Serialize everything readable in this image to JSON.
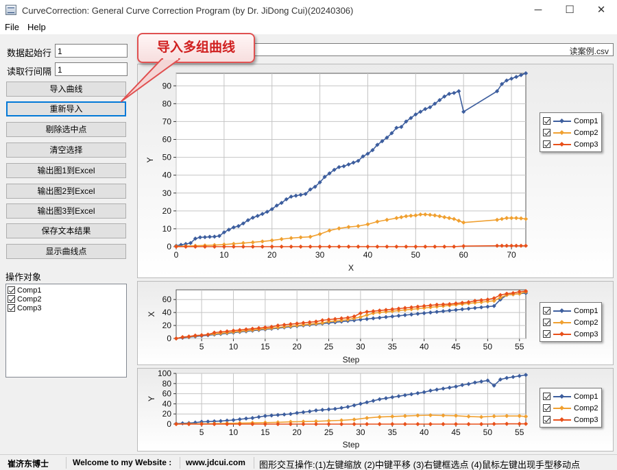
{
  "window": {
    "title": "CurveCorrection: General Curve Correction Program (by Dr. JiDong Cui)(20240306)",
    "minimize_glyph": "─",
    "maximize_glyph": "☐",
    "close_glyph": "✕"
  },
  "menu": {
    "items": [
      "File",
      "Help"
    ]
  },
  "params": {
    "start_row_label": "数据起始行",
    "start_row_value": "1",
    "interval_label": "读取行间隔",
    "interval_value": "1"
  },
  "file_path_visible": "读案例.csv",
  "buttons": [
    "导入曲线",
    "重新导入",
    "剔除选中点",
    "清空选择",
    "输出图1到Excel",
    "输出图2到Excel",
    "输出图3到Excel",
    "保存文本结果",
    "显示曲线点"
  ],
  "callout_text": "导入多组曲线",
  "targets": {
    "label": "操作对象",
    "items": [
      "Comp1",
      "Comp2",
      "Comp3"
    ]
  },
  "status": {
    "author": "崔济东博士",
    "welcome": "Welcome to my Website :",
    "website": "www.jdcui.com",
    "hint": "图形交互操作:(1)左键缩放 (2)中键平移 (3)右键框选点 (4)鼠标左键出现手型移动点"
  },
  "colors": {
    "comp1": "#3d5e9e",
    "comp2": "#f0a030",
    "comp3": "#e8501a",
    "focus": "#0078d7",
    "callout": "#d02020"
  },
  "chart_data": [
    {
      "type": "line",
      "xlabel": "X",
      "ylabel": "Y",
      "xlim": [
        0,
        73
      ],
      "ylim": [
        0,
        97
      ],
      "xticks": [
        0,
        10,
        20,
        30,
        40,
        50,
        60,
        70
      ],
      "yticks": [
        0,
        10,
        20,
        30,
        40,
        50,
        60,
        70,
        80,
        90
      ],
      "grid": true,
      "legend": "right",
      "series": [
        {
          "name": "Comp1",
          "color": "#3d5e9e",
          "x": [
            0,
            1,
            2,
            3,
            4,
            5,
            6,
            7,
            8,
            9,
            10,
            11,
            12,
            13,
            14,
            15,
            16,
            17,
            18,
            19,
            20,
            21,
            22,
            23,
            24,
            25,
            26,
            27,
            28,
            29,
            30,
            31,
            32,
            33,
            34,
            35,
            36,
            37,
            38,
            39,
            40,
            41,
            42,
            43,
            44,
            45,
            46,
            47,
            48,
            49,
            50,
            51,
            52,
            53,
            54,
            55,
            56,
            57,
            58,
            59,
            60,
            67,
            68,
            69,
            70,
            71,
            72,
            73
          ],
          "y": [
            0.5,
            1,
            1.5,
            2,
            4.5,
            5.2,
            5.3,
            5.5,
            5.6,
            6,
            8,
            9.5,
            10.8,
            11.5,
            13,
            14.8,
            16.2,
            17.2,
            18.3,
            19.5,
            21,
            23,
            24.5,
            26.5,
            28,
            28.5,
            29,
            29.5,
            32,
            33.5,
            36,
            39,
            41,
            43,
            44.5,
            45,
            46,
            47,
            48,
            50.5,
            52,
            54,
            57,
            59,
            61,
            63.5,
            66.5,
            67,
            70,
            72,
            74,
            75.5,
            77,
            78,
            80,
            82,
            84,
            85.5,
            86,
            87,
            75.5,
            87,
            91,
            93,
            94,
            95,
            96,
            97
          ]
        },
        {
          "name": "Comp2",
          "color": "#f0a030",
          "x": [
            0,
            2,
            4,
            6,
            8,
            10,
            12,
            14,
            16,
            18,
            20,
            22,
            24,
            26,
            28,
            30,
            32,
            34,
            36,
            38,
            40,
            42,
            44,
            46,
            47,
            48,
            49,
            50,
            51,
            52,
            53,
            54,
            55,
            56,
            57,
            58,
            59,
            60,
            67,
            68,
            69,
            70,
            71,
            72,
            73
          ],
          "y": [
            0.2,
            0.3,
            0.5,
            0.7,
            0.9,
            1.2,
            1.6,
            2,
            2.4,
            2.9,
            3.5,
            4.2,
            4.8,
            5.2,
            5.5,
            7,
            9,
            10.2,
            11,
            11.5,
            12.5,
            14,
            15,
            16,
            16.5,
            17,
            17.3,
            17.5,
            18,
            18,
            17.8,
            17.5,
            17,
            16.5,
            16,
            15.5,
            14.5,
            13.5,
            15,
            15.5,
            16,
            16,
            16,
            15.8,
            15.5
          ]
        },
        {
          "name": "Comp3",
          "color": "#e8501a",
          "x": [
            0,
            2,
            4,
            6,
            8,
            10,
            12,
            14,
            16,
            18,
            20,
            22,
            24,
            26,
            28,
            30,
            32,
            34,
            36,
            38,
            40,
            42,
            44,
            46,
            48,
            50,
            52,
            54,
            56,
            58,
            60,
            67,
            68,
            69,
            70,
            71,
            72,
            73
          ],
          "y": [
            0,
            0,
            0,
            0,
            0,
            0,
            0,
            0,
            0,
            0,
            0,
            0,
            0,
            0,
            0,
            0,
            0,
            0,
            0,
            0,
            0,
            0,
            0,
            0,
            0,
            0,
            0,
            0,
            0,
            0,
            0.3,
            0.5,
            0.5,
            0.5,
            0.5,
            0.5,
            0.5,
            0.5
          ]
        }
      ]
    },
    {
      "type": "line",
      "xlabel": "Step",
      "ylabel": "X",
      "xlim": [
        1,
        56
      ],
      "ylim": [
        0,
        75
      ],
      "xticks": [
        5,
        10,
        15,
        20,
        25,
        30,
        35,
        40,
        45,
        50,
        55
      ],
      "yticks": [
        0,
        20,
        40,
        60
      ],
      "grid": true,
      "legend": "right",
      "series": [
        {
          "name": "Comp1",
          "color": "#3d5e9e",
          "x": [
            1,
            2,
            3,
            4,
            5,
            6,
            7,
            8,
            9,
            10,
            11,
            12,
            13,
            14,
            15,
            16,
            17,
            18,
            19,
            20,
            21,
            22,
            23,
            24,
            25,
            26,
            27,
            28,
            29,
            30,
            31,
            32,
            33,
            34,
            35,
            36,
            37,
            38,
            39,
            40,
            41,
            42,
            43,
            44,
            45,
            46,
            47,
            48,
            49,
            50,
            51,
            52,
            53,
            54,
            55,
            56
          ],
          "y": [
            0,
            1,
            2,
            3,
            4,
            5,
            6,
            7,
            8,
            9,
            10,
            11,
            12,
            13,
            14,
            15,
            16,
            17,
            18,
            19,
            20,
            21,
            22,
            23,
            24,
            25,
            26,
            27,
            28,
            29,
            30,
            31,
            32,
            33,
            34,
            35,
            36,
            37,
            38,
            39,
            40,
            41,
            42,
            43,
            44,
            45,
            46,
            47,
            48,
            49,
            50,
            60,
            67,
            68,
            69,
            70
          ]
        },
        {
          "name": "Comp2",
          "color": "#f0a030",
          "x": [
            1,
            2,
            3,
            4,
            5,
            6,
            7,
            8,
            9,
            10,
            11,
            12,
            13,
            14,
            15,
            16,
            17,
            18,
            19,
            20,
            21,
            22,
            23,
            24,
            25,
            26,
            27,
            28,
            29,
            30,
            31,
            32,
            33,
            34,
            35,
            36,
            37,
            38,
            39,
            40,
            41,
            42,
            43,
            44,
            45,
            46,
            47,
            48,
            49,
            50,
            51,
            52,
            53,
            54,
            55,
            56
          ],
          "y": [
            0,
            2,
            2.5,
            4,
            5,
            6,
            7,
            8,
            9,
            10,
            11,
            12,
            13,
            14,
            15,
            16,
            17,
            18,
            19,
            20,
            21,
            22,
            23,
            24,
            26,
            27,
            28,
            29,
            31,
            33,
            36,
            39,
            40,
            41,
            42,
            43,
            44,
            45,
            46,
            47,
            48,
            49,
            50,
            51,
            52,
            53,
            54,
            55,
            56,
            57,
            58,
            63,
            67,
            68,
            69,
            72
          ]
        },
        {
          "name": "Comp3",
          "color": "#e8501a",
          "x": [
            1,
            2,
            3,
            4,
            5,
            6,
            7,
            8,
            9,
            10,
            11,
            12,
            13,
            14,
            15,
            16,
            17,
            18,
            19,
            20,
            21,
            22,
            23,
            24,
            25,
            26,
            27,
            28,
            29,
            30,
            31,
            32,
            33,
            34,
            35,
            36,
            37,
            38,
            39,
            40,
            41,
            42,
            43,
            44,
            45,
            46,
            47,
            48,
            49,
            50,
            51,
            52,
            53,
            54,
            55,
            56
          ],
          "y": [
            0,
            2,
            3,
            4.5,
            5,
            6,
            9,
            10,
            11,
            12,
            13,
            14,
            15,
            16,
            17,
            18,
            20,
            21,
            22,
            23,
            24,
            25,
            26,
            28,
            29,
            30,
            31,
            32,
            34,
            39,
            41,
            42,
            43,
            44,
            45,
            46,
            47,
            48,
            49,
            50,
            51,
            52,
            52.5,
            53,
            54,
            55,
            56,
            58,
            59,
            60,
            62,
            67,
            69,
            70,
            72,
            73
          ]
        }
      ]
    },
    {
      "type": "line",
      "xlabel": "Step",
      "ylabel": "Y",
      "xlim": [
        1,
        56
      ],
      "ylim": [
        0,
        100
      ],
      "xticks": [
        5,
        10,
        15,
        20,
        25,
        30,
        35,
        40,
        45,
        50,
        55
      ],
      "yticks": [
        0,
        20,
        40,
        60,
        80,
        100
      ],
      "grid": true,
      "legend": "right",
      "series": [
        {
          "name": "Comp1",
          "color": "#3d5e9e",
          "x": [
            1,
            2,
            3,
            4,
            5,
            6,
            7,
            8,
            9,
            10,
            11,
            12,
            13,
            14,
            15,
            16,
            17,
            18,
            19,
            20,
            21,
            22,
            23,
            24,
            25,
            26,
            27,
            28,
            29,
            30,
            31,
            32,
            33,
            34,
            35,
            36,
            37,
            38,
            39,
            40,
            41,
            42,
            43,
            44,
            45,
            46,
            47,
            48,
            49,
            50,
            51,
            52,
            53,
            54,
            55,
            56
          ],
          "y": [
            1,
            1.5,
            2,
            3,
            4.5,
            5,
            5.5,
            6,
            7,
            8,
            9.5,
            11,
            12,
            14,
            16,
            17,
            18,
            19,
            20,
            22,
            23.5,
            25,
            27,
            28,
            29,
            30,
            32,
            34,
            37,
            40,
            43,
            46,
            49,
            51,
            53,
            55,
            57,
            59,
            61,
            63,
            66,
            68,
            70,
            72,
            74,
            77,
            79,
            82,
            84,
            86,
            76,
            88,
            91,
            93,
            95,
            97
          ]
        },
        {
          "name": "Comp2",
          "color": "#f0a030",
          "x": [
            1,
            3,
            5,
            7,
            9,
            11,
            13,
            15,
            17,
            19,
            21,
            23,
            25,
            27,
            29,
            31,
            33,
            35,
            37,
            39,
            41,
            43,
            45,
            47,
            49,
            51,
            53,
            55,
            56
          ],
          "y": [
            0.3,
            0.5,
            0.7,
            1,
            1.5,
            2,
            2.5,
            3,
            3.5,
            4.5,
            5,
            5.5,
            6.5,
            7.5,
            9,
            12,
            14,
            15,
            16,
            17,
            17.5,
            17,
            16.5,
            15,
            14,
            15.5,
            16,
            16,
            15
          ]
        },
        {
          "name": "Comp3",
          "color": "#e8501a",
          "x": [
            1,
            3,
            5,
            7,
            9,
            11,
            13,
            15,
            17,
            19,
            21,
            23,
            25,
            27,
            29,
            31,
            33,
            35,
            37,
            39,
            41,
            43,
            45,
            47,
            49,
            51,
            53,
            55,
            56
          ],
          "y": [
            0,
            0,
            0,
            0,
            0,
            0,
            0,
            0,
            0,
            0,
            0,
            0,
            0,
            0,
            0,
            0,
            0,
            0,
            0,
            0,
            0,
            0,
            0,
            0,
            0,
            0.3,
            0.5,
            0.5,
            0.5
          ]
        }
      ]
    }
  ]
}
